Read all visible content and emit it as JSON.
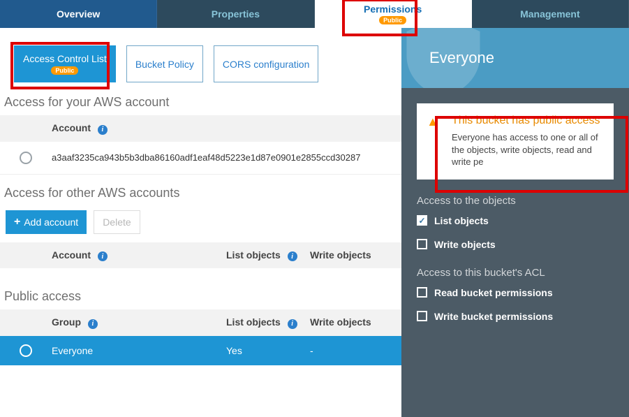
{
  "tabs": {
    "overview": "Overview",
    "properties": "Properties",
    "permissions": "Permissions",
    "management": "Management",
    "public_badge": "Public"
  },
  "subtabs": {
    "acl": "Access Control List",
    "acl_badge": "Public",
    "bucket_policy": "Bucket Policy",
    "cors": "CORS configuration"
  },
  "account_section": {
    "title": "Access for your AWS account",
    "header_account": "Account",
    "row_id": "a3aaf3235ca943b5b3dba86160adf1eaf48d5223e1d87e0901e2855ccd30287"
  },
  "other_accounts": {
    "title": "Access for other AWS accounts",
    "add_label": "Add account",
    "delete_label": "Delete",
    "header_account": "Account",
    "header_list": "List objects",
    "header_write": "Write objects"
  },
  "public_access": {
    "title": "Public access",
    "header_group": "Group",
    "header_list": "List objects",
    "header_write": "Write objects",
    "row": {
      "group": "Everyone",
      "list": "Yes",
      "write": "-"
    }
  },
  "panel": {
    "heading": "Everyone",
    "warning_title": "This bucket has public access",
    "warning_body": "Everyone has access to one or all of the objects, write objects, read and write pe",
    "section_objects": "Access to the objects",
    "list_objects": "List objects",
    "write_objects": "Write objects",
    "section_acl": "Access to this bucket's ACL",
    "read_bucket_perm": "Read bucket permissions",
    "write_bucket_perm": "Write bucket permissions"
  }
}
